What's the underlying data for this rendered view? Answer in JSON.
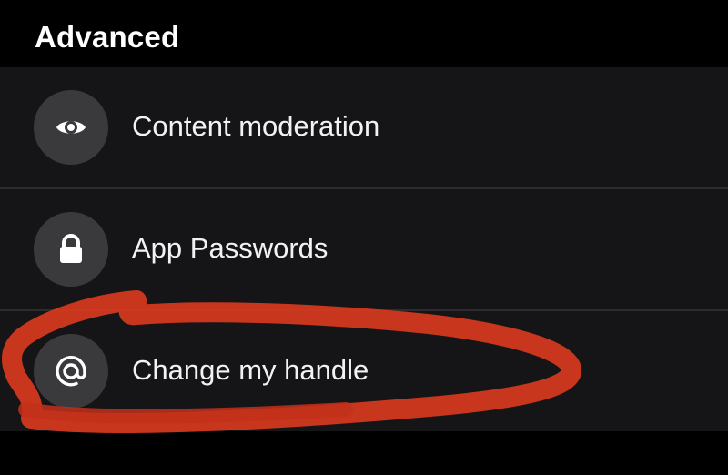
{
  "section": {
    "title": "Advanced"
  },
  "items": [
    {
      "label": "Content moderation",
      "icon": "eye-icon"
    },
    {
      "label": "App Passwords",
      "icon": "lock-icon"
    },
    {
      "label": "Change my handle",
      "icon": "at-icon"
    }
  ],
  "colors": {
    "background": "#000000",
    "row": "#151517",
    "icon_circle": "#3a3a3c",
    "text": "#f2f2f2",
    "annotation": "#d73a1e"
  }
}
